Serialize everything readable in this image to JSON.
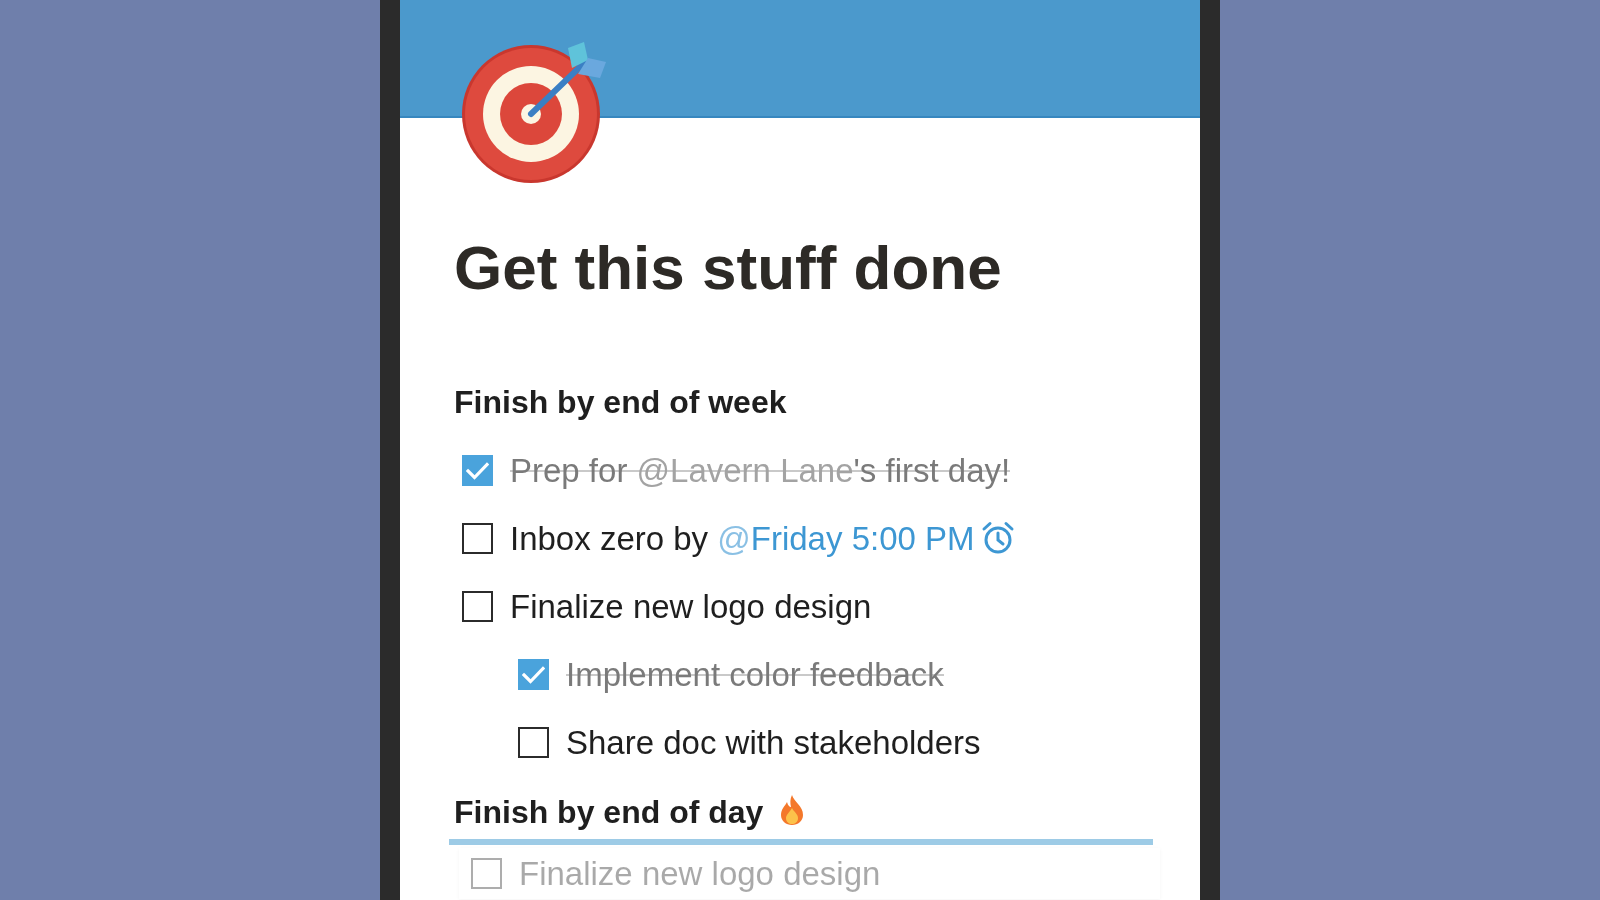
{
  "page": {
    "title": "Get this stuff done"
  },
  "sections": [
    {
      "heading": "Finish by end of week",
      "tasks": [
        {
          "checked": true,
          "parts": [
            {
              "kind": "text",
              "text": "Prep for "
            },
            {
              "kind": "mention",
              "at": "@",
              "text": "Lavern Lane"
            },
            {
              "kind": "text",
              "text": "'s first day!"
            }
          ]
        },
        {
          "checked": false,
          "parts": [
            {
              "kind": "text",
              "text": "Inbox zero by "
            },
            {
              "kind": "reminder",
              "at": "@",
              "text": "Friday 5:00 PM"
            }
          ]
        },
        {
          "checked": false,
          "parts": [
            {
              "kind": "text",
              "text": "Finalize new logo design"
            }
          ],
          "children": [
            {
              "checked": true,
              "parts": [
                {
                  "kind": "text",
                  "text": "Implement color feedback"
                }
              ]
            },
            {
              "checked": false,
              "parts": [
                {
                  "kind": "text",
                  "text": "Share doc with stakeholders"
                }
              ]
            }
          ]
        }
      ]
    },
    {
      "heading": "Finish by end of day",
      "drag_preview": {
        "checked": false,
        "parts": [
          {
            "kind": "text",
            "text": "Finalize new logo design"
          }
        ]
      }
    }
  ]
}
